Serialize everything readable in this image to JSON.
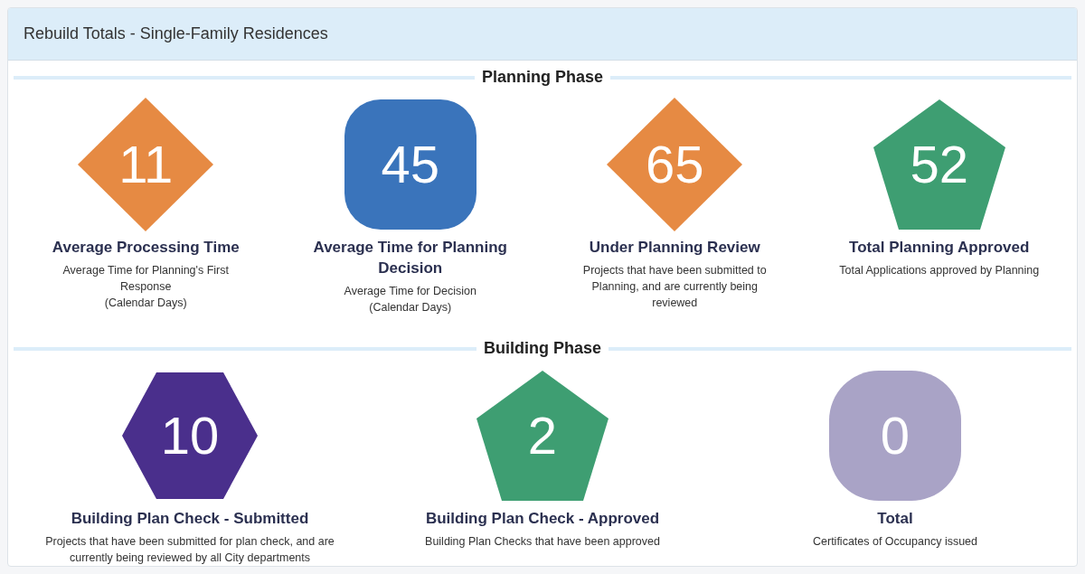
{
  "panel": {
    "title": "Rebuild Totals - Single-Family Residences"
  },
  "sections": [
    {
      "title": "Planning Phase",
      "metrics": [
        {
          "value": "11",
          "kind": "diamond",
          "color": "#e68a43",
          "title": "Average Processing Time",
          "description": [
            "Average Time for Planning's First Response",
            "(Calendar Days)"
          ]
        },
        {
          "value": "45",
          "kind": "rounded-square",
          "color": "#3a74bb",
          "title": "Average Time for Planning Decision",
          "description": [
            "Average Time for Decision",
            "(Calendar Days)"
          ]
        },
        {
          "value": "65",
          "kind": "diamond",
          "color": "#e68a43",
          "title": "Under Planning Review",
          "description": [
            "Projects that have been submitted to Planning, and are currently being reviewed"
          ]
        },
        {
          "value": "52",
          "kind": "pentagon",
          "color": "#3e9e72",
          "title": "Total Planning Approved",
          "description": [
            "Total Applications approved by Planning"
          ]
        }
      ]
    },
    {
      "title": "Building Phase",
      "metrics": [
        {
          "value": "10",
          "kind": "hexagon",
          "color": "#4a2f8c",
          "title": "Building Plan Check - Submitted",
          "description": [
            "Projects that have been submitted for plan check, and are currently being reviewed by all City departments"
          ]
        },
        {
          "value": "2",
          "kind": "pentagon",
          "color": "#3e9e72",
          "title": "Building Plan Check - Approved",
          "description": [
            "Building Plan Checks that have been approved"
          ]
        },
        {
          "value": "0",
          "kind": "rounded-circle",
          "color": "#a9a3c6",
          "title": "Total",
          "description": [
            "Certificates of Occupancy issued"
          ]
        }
      ]
    }
  ]
}
